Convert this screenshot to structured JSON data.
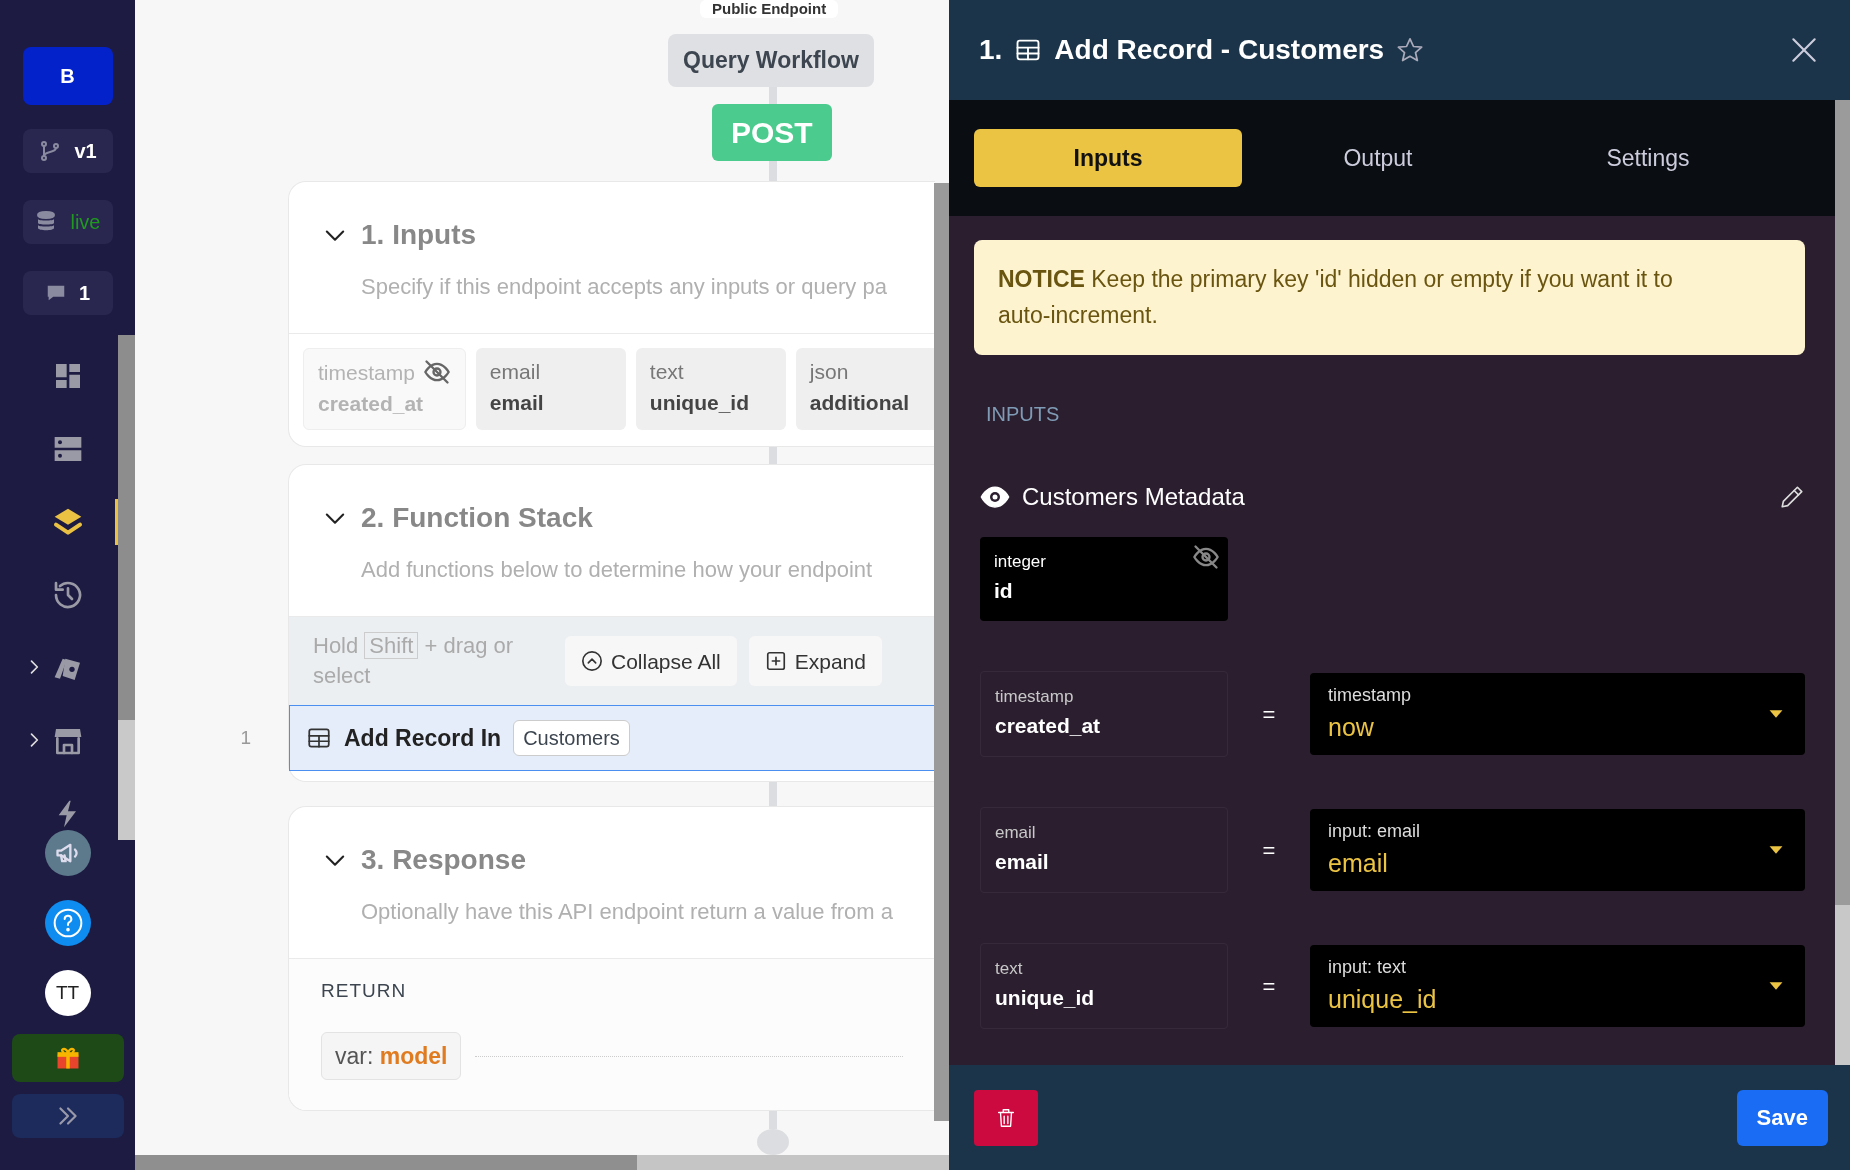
{
  "sidebar": {
    "workspace_button": "B",
    "status_items": [
      {
        "kind": "branch",
        "label": "v1"
      },
      {
        "kind": "database",
        "label": "live"
      },
      {
        "kind": "comment",
        "label": "1"
      }
    ],
    "nav": [
      {
        "kind": "dashboard",
        "selected": false,
        "expandable": false
      },
      {
        "kind": "server",
        "selected": false,
        "expandable": false
      },
      {
        "kind": "api",
        "selected": true,
        "expandable": false
      },
      {
        "kind": "history",
        "selected": false,
        "expandable": false
      },
      {
        "kind": "cards",
        "selected": false,
        "expandable": true
      },
      {
        "kind": "store",
        "selected": false,
        "expandable": true
      },
      {
        "kind": "bolt",
        "selected": false,
        "expandable": false
      }
    ],
    "bottom": [
      {
        "kind": "megaphone"
      },
      {
        "kind": "help"
      },
      {
        "kind": "avatar",
        "label": "TT"
      },
      {
        "kind": "gift"
      },
      {
        "kind": "collapse"
      }
    ]
  },
  "canvas": {
    "endpoint_label": "Public Endpoint",
    "workflow_label": "Query Workflow",
    "method": "POST",
    "inputs_section": {
      "title": "1. Inputs",
      "expanded": true,
      "description": "Specify if this endpoint accepts any inputs or query pa",
      "fields": [
        {
          "type": "timestamp",
          "name": "created_at",
          "hidden": true
        },
        {
          "type": "email",
          "name": "email",
          "hidden": false
        },
        {
          "type": "text",
          "name": "unique_id",
          "hidden": false
        },
        {
          "type": "json",
          "name": "additional",
          "hidden": false
        }
      ]
    },
    "function_stack": {
      "title": "2. Function Stack",
      "expanded": true,
      "description": "Add functions below to determine how your endpoint",
      "hint_start": "Hold",
      "hint_key": "Shift",
      "hint_end": "+ drag or select",
      "buttons": [
        {
          "kind": "collapse",
          "label": "Collapse All"
        },
        {
          "kind": "expand",
          "label": "Expand"
        }
      ],
      "steps": [
        {
          "number": "1",
          "label": "Add Record In",
          "table": "Customers",
          "selected": true
        }
      ]
    },
    "response": {
      "title": "3. Response",
      "expanded": true,
      "description": "Optionally have this API endpoint return a value from a",
      "return_label": "RETURN",
      "return_prefix": "var:",
      "return_name": "model"
    }
  },
  "panel": {
    "step_number": "1.",
    "title": "Add Record - Customers",
    "favorite": false,
    "tabs": [
      {
        "label": "Inputs",
        "selected": true
      },
      {
        "label": "Output",
        "selected": false
      },
      {
        "label": "Settings",
        "selected": false
      }
    ],
    "notice": "**NOTICE** Keep the primary key 'id' hidden or empty if you want it to auto-increment.",
    "section_label": "INPUTS",
    "group": {
      "title": "Customers Metadata",
      "visible": true
    },
    "fixed_field": {
      "type": "integer",
      "name": "id",
      "hidden": true
    },
    "mappings": [
      {
        "type": "timestamp",
        "name": "created_at",
        "operator": "=",
        "source": "timestamp",
        "value": "now"
      },
      {
        "type": "email",
        "name": "email",
        "operator": "=",
        "source": "input: email",
        "value": "email"
      },
      {
        "type": "text",
        "name": "unique_id",
        "operator": "=",
        "source": "input: text",
        "value": "unique_id"
      }
    ],
    "save_label": "Save"
  }
}
